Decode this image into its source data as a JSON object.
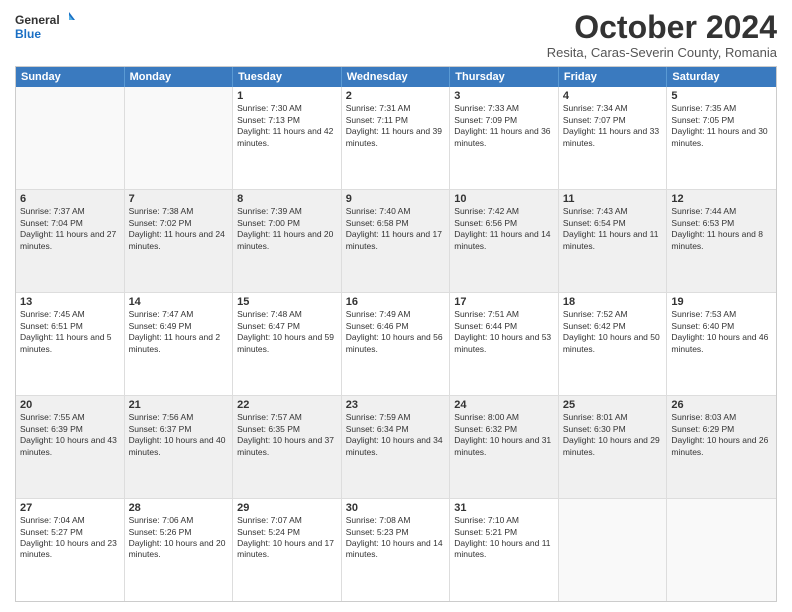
{
  "header": {
    "logo_line1": "General",
    "logo_line2": "Blue",
    "title": "October 2024",
    "subtitle": "Resita, Caras-Severin County, Romania"
  },
  "days": [
    "Sunday",
    "Monday",
    "Tuesday",
    "Wednesday",
    "Thursday",
    "Friday",
    "Saturday"
  ],
  "weeks": [
    [
      {
        "day": "",
        "sunrise": "",
        "sunset": "",
        "daylight": "",
        "empty": true
      },
      {
        "day": "",
        "sunrise": "",
        "sunset": "",
        "daylight": "",
        "empty": true
      },
      {
        "day": "1",
        "sunrise": "Sunrise: 7:30 AM",
        "sunset": "Sunset: 7:13 PM",
        "daylight": "Daylight: 11 hours and 42 minutes."
      },
      {
        "day": "2",
        "sunrise": "Sunrise: 7:31 AM",
        "sunset": "Sunset: 7:11 PM",
        "daylight": "Daylight: 11 hours and 39 minutes."
      },
      {
        "day": "3",
        "sunrise": "Sunrise: 7:33 AM",
        "sunset": "Sunset: 7:09 PM",
        "daylight": "Daylight: 11 hours and 36 minutes."
      },
      {
        "day": "4",
        "sunrise": "Sunrise: 7:34 AM",
        "sunset": "Sunset: 7:07 PM",
        "daylight": "Daylight: 11 hours and 33 minutes."
      },
      {
        "day": "5",
        "sunrise": "Sunrise: 7:35 AM",
        "sunset": "Sunset: 7:05 PM",
        "daylight": "Daylight: 11 hours and 30 minutes."
      }
    ],
    [
      {
        "day": "6",
        "sunrise": "Sunrise: 7:37 AM",
        "sunset": "Sunset: 7:04 PM",
        "daylight": "Daylight: 11 hours and 27 minutes."
      },
      {
        "day": "7",
        "sunrise": "Sunrise: 7:38 AM",
        "sunset": "Sunset: 7:02 PM",
        "daylight": "Daylight: 11 hours and 24 minutes."
      },
      {
        "day": "8",
        "sunrise": "Sunrise: 7:39 AM",
        "sunset": "Sunset: 7:00 PM",
        "daylight": "Daylight: 11 hours and 20 minutes."
      },
      {
        "day": "9",
        "sunrise": "Sunrise: 7:40 AM",
        "sunset": "Sunset: 6:58 PM",
        "daylight": "Daylight: 11 hours and 17 minutes."
      },
      {
        "day": "10",
        "sunrise": "Sunrise: 7:42 AM",
        "sunset": "Sunset: 6:56 PM",
        "daylight": "Daylight: 11 hours and 14 minutes."
      },
      {
        "day": "11",
        "sunrise": "Sunrise: 7:43 AM",
        "sunset": "Sunset: 6:54 PM",
        "daylight": "Daylight: 11 hours and 11 minutes."
      },
      {
        "day": "12",
        "sunrise": "Sunrise: 7:44 AM",
        "sunset": "Sunset: 6:53 PM",
        "daylight": "Daylight: 11 hours and 8 minutes."
      }
    ],
    [
      {
        "day": "13",
        "sunrise": "Sunrise: 7:45 AM",
        "sunset": "Sunset: 6:51 PM",
        "daylight": "Daylight: 11 hours and 5 minutes."
      },
      {
        "day": "14",
        "sunrise": "Sunrise: 7:47 AM",
        "sunset": "Sunset: 6:49 PM",
        "daylight": "Daylight: 11 hours and 2 minutes."
      },
      {
        "day": "15",
        "sunrise": "Sunrise: 7:48 AM",
        "sunset": "Sunset: 6:47 PM",
        "daylight": "Daylight: 10 hours and 59 minutes."
      },
      {
        "day": "16",
        "sunrise": "Sunrise: 7:49 AM",
        "sunset": "Sunset: 6:46 PM",
        "daylight": "Daylight: 10 hours and 56 minutes."
      },
      {
        "day": "17",
        "sunrise": "Sunrise: 7:51 AM",
        "sunset": "Sunset: 6:44 PM",
        "daylight": "Daylight: 10 hours and 53 minutes."
      },
      {
        "day": "18",
        "sunrise": "Sunrise: 7:52 AM",
        "sunset": "Sunset: 6:42 PM",
        "daylight": "Daylight: 10 hours and 50 minutes."
      },
      {
        "day": "19",
        "sunrise": "Sunrise: 7:53 AM",
        "sunset": "Sunset: 6:40 PM",
        "daylight": "Daylight: 10 hours and 46 minutes."
      }
    ],
    [
      {
        "day": "20",
        "sunrise": "Sunrise: 7:55 AM",
        "sunset": "Sunset: 6:39 PM",
        "daylight": "Daylight: 10 hours and 43 minutes."
      },
      {
        "day": "21",
        "sunrise": "Sunrise: 7:56 AM",
        "sunset": "Sunset: 6:37 PM",
        "daylight": "Daylight: 10 hours and 40 minutes."
      },
      {
        "day": "22",
        "sunrise": "Sunrise: 7:57 AM",
        "sunset": "Sunset: 6:35 PM",
        "daylight": "Daylight: 10 hours and 37 minutes."
      },
      {
        "day": "23",
        "sunrise": "Sunrise: 7:59 AM",
        "sunset": "Sunset: 6:34 PM",
        "daylight": "Daylight: 10 hours and 34 minutes."
      },
      {
        "day": "24",
        "sunrise": "Sunrise: 8:00 AM",
        "sunset": "Sunset: 6:32 PM",
        "daylight": "Daylight: 10 hours and 31 minutes."
      },
      {
        "day": "25",
        "sunrise": "Sunrise: 8:01 AM",
        "sunset": "Sunset: 6:30 PM",
        "daylight": "Daylight: 10 hours and 29 minutes."
      },
      {
        "day": "26",
        "sunrise": "Sunrise: 8:03 AM",
        "sunset": "Sunset: 6:29 PM",
        "daylight": "Daylight: 10 hours and 26 minutes."
      }
    ],
    [
      {
        "day": "27",
        "sunrise": "Sunrise: 7:04 AM",
        "sunset": "Sunset: 5:27 PM",
        "daylight": "Daylight: 10 hours and 23 minutes."
      },
      {
        "day": "28",
        "sunrise": "Sunrise: 7:06 AM",
        "sunset": "Sunset: 5:26 PM",
        "daylight": "Daylight: 10 hours and 20 minutes."
      },
      {
        "day": "29",
        "sunrise": "Sunrise: 7:07 AM",
        "sunset": "Sunset: 5:24 PM",
        "daylight": "Daylight: 10 hours and 17 minutes."
      },
      {
        "day": "30",
        "sunrise": "Sunrise: 7:08 AM",
        "sunset": "Sunset: 5:23 PM",
        "daylight": "Daylight: 10 hours and 14 minutes."
      },
      {
        "day": "31",
        "sunrise": "Sunrise: 7:10 AM",
        "sunset": "Sunset: 5:21 PM",
        "daylight": "Daylight: 10 hours and 11 minutes."
      },
      {
        "day": "",
        "sunrise": "",
        "sunset": "",
        "daylight": "",
        "empty": true
      },
      {
        "day": "",
        "sunrise": "",
        "sunset": "",
        "daylight": "",
        "empty": true
      }
    ]
  ]
}
